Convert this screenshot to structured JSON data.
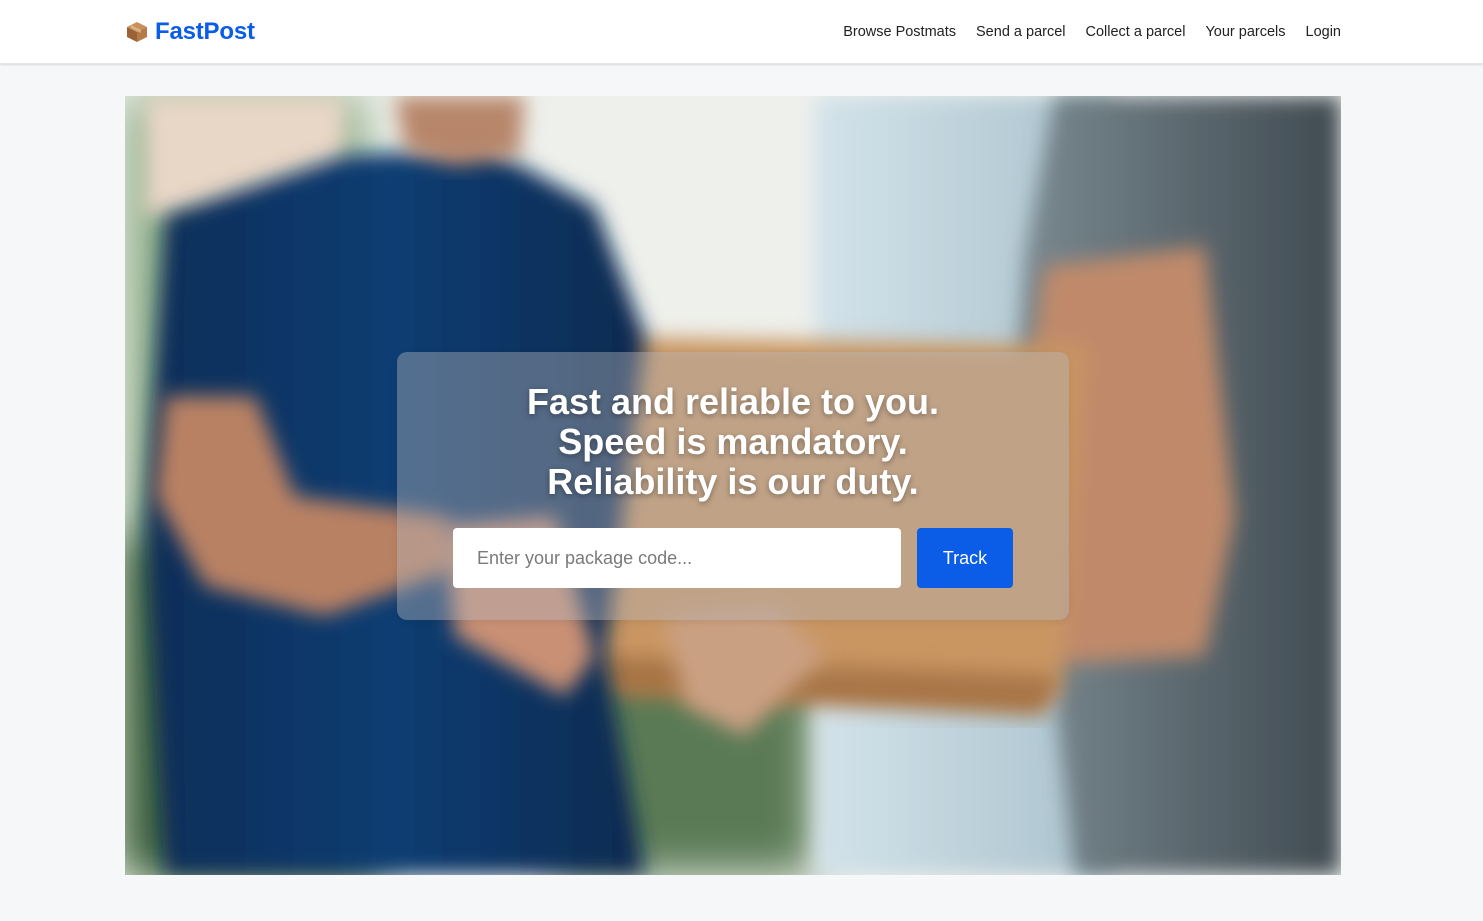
{
  "brand": {
    "name": "FastPost",
    "icon": "package-box-icon",
    "color": "#0b5ce6"
  },
  "nav": {
    "items": [
      {
        "label": "Browse Postmats"
      },
      {
        "label": "Send a parcel"
      },
      {
        "label": "Collect a parcel"
      },
      {
        "label": "Your parcels"
      },
      {
        "label": "Login"
      }
    ]
  },
  "hero": {
    "image_subject": "courier handing a cardboard box to a customer",
    "headline_lines": [
      "Fast and reliable to you.",
      "Speed is mandatory.",
      "Reliability is our duty."
    ],
    "track": {
      "placeholder": "Enter your package code...",
      "value": "",
      "button_label": "Track",
      "button_color": "#0b5ce6"
    }
  }
}
